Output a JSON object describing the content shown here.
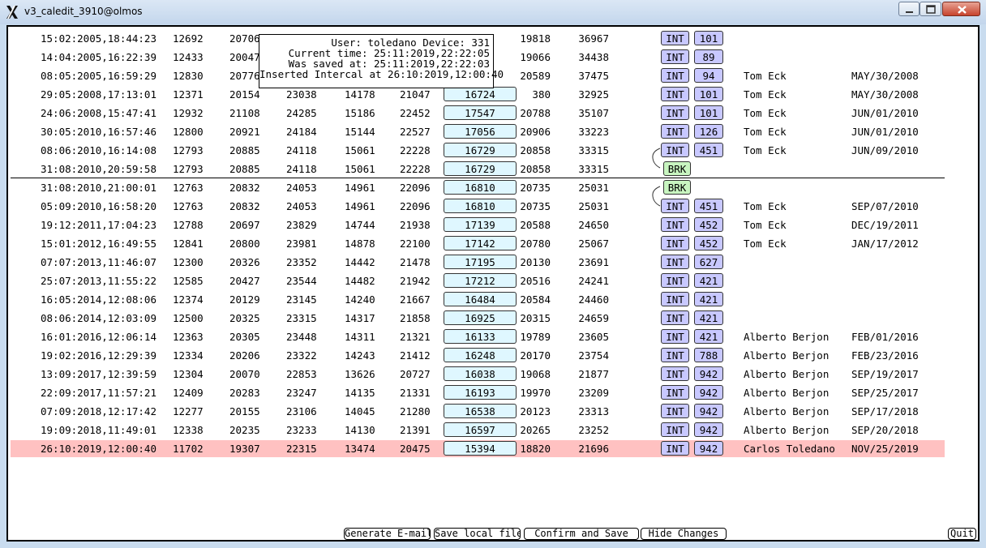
{
  "window": {
    "title": "v3_caledit_3910@olmos",
    "controls": [
      "minimize-icon",
      "maximize-icon",
      "close-icon"
    ]
  },
  "overlay": {
    "user_line": "User: toledano Device: 331",
    "current_time_line": "Current time: 25:11:2019,22:22:05",
    "saved_line": "Was saved at: 25:11:2019,22:22:03",
    "inserted_line": "Inserted Intercal at 26:10:2019,12:00:40"
  },
  "rows_before_break": [
    {
      "ts": "15:02:2005,18:44:23",
      "a": "12692",
      "b": "20706",
      "c": "",
      "d": "",
      "e": "",
      "id": "",
      "f": "19818",
      "g": "36967",
      "tag": "INT",
      "num": "101",
      "name": "",
      "date": ""
    },
    {
      "ts": "14:04:2005,16:22:39",
      "a": "12433",
      "b": "20047",
      "c": "",
      "d": "",
      "e": "",
      "id": "",
      "f": "19066",
      "g": "34438",
      "tag": "INT",
      "num": "89",
      "name": "",
      "date": ""
    },
    {
      "ts": "08:05:2005,16:59:29",
      "a": "12830",
      "b": "20776",
      "c": "",
      "d": "",
      "e": "",
      "id": "",
      "f": "20589",
      "g": "37475",
      "tag": "INT",
      "num": "94",
      "name": "Tom Eck",
      "date": "MAY/30/2008"
    },
    {
      "ts": "29:05:2008,17:13:01",
      "a": "12371",
      "b": "20154",
      "c": "23038",
      "d": "14178",
      "e": "21047",
      "id": "16724",
      "f": "380",
      "g": "32925",
      "tag": "INT",
      "num": "101",
      "name": "Tom Eck",
      "date": "MAY/30/2008"
    },
    {
      "ts": "24:06:2008,15:47:41",
      "a": "12932",
      "b": "21108",
      "c": "24285",
      "d": "15186",
      "e": "22452",
      "id": "17547",
      "f": "20788",
      "g": "35107",
      "tag": "INT",
      "num": "101",
      "name": "Tom Eck",
      "date": "JUN/01/2010"
    },
    {
      "ts": "30:05:2010,16:57:46",
      "a": "12800",
      "b": "20921",
      "c": "24184",
      "d": "15144",
      "e": "22527",
      "id": "17056",
      "f": "20906",
      "g": "33223",
      "tag": "INT",
      "num": "126",
      "name": "Tom Eck",
      "date": "JUN/01/2010"
    },
    {
      "ts": "08:06:2010,16:14:08",
      "a": "12793",
      "b": "20885",
      "c": "24118",
      "d": "15061",
      "e": "22228",
      "id": "16729",
      "f": "20858",
      "g": "33315",
      "tag": "INT",
      "num": "451",
      "name": "Tom Eck",
      "date": "JUN/09/2010"
    },
    {
      "ts": "31:08:2010,20:59:58",
      "a": "12793",
      "b": "20885",
      "c": "24118",
      "d": "15061",
      "e": "22228",
      "id": "16729",
      "f": "20858",
      "g": "33315",
      "tag": "BRK",
      "num": "",
      "name": "",
      "date": ""
    }
  ],
  "rows_after_break": [
    {
      "ts": "31:08:2010,21:00:01",
      "a": "12763",
      "b": "20832",
      "c": "24053",
      "d": "14961",
      "e": "22096",
      "id": "16810",
      "f": "20735",
      "g": "25031",
      "tag": "BRK",
      "num": "",
      "name": "",
      "date": ""
    },
    {
      "ts": "05:09:2010,16:58:20",
      "a": "12763",
      "b": "20832",
      "c": "24053",
      "d": "14961",
      "e": "22096",
      "id": "16810",
      "f": "20735",
      "g": "25031",
      "tag": "INT",
      "num": "451",
      "name": "Tom Eck",
      "date": "SEP/07/2010"
    },
    {
      "ts": "19:12:2011,17:04:23",
      "a": "12788",
      "b": "20697",
      "c": "23829",
      "d": "14744",
      "e": "21938",
      "id": "17139",
      "f": "20588",
      "g": "24650",
      "tag": "INT",
      "num": "452",
      "name": "Tom Eck",
      "date": "DEC/19/2011"
    },
    {
      "ts": "15:01:2012,16:49:55",
      "a": "12841",
      "b": "20800",
      "c": "23981",
      "d": "14878",
      "e": "22100",
      "id": "17142",
      "f": "20780",
      "g": "25067",
      "tag": "INT",
      "num": "452",
      "name": "Tom Eck",
      "date": "JAN/17/2012"
    },
    {
      "ts": "07:07:2013,11:46:07",
      "a": "12300",
      "b": "20326",
      "c": "23352",
      "d": "14442",
      "e": "21478",
      "id": "17195",
      "f": "20130",
      "g": "23691",
      "tag": "INT",
      "num": "627",
      "name": "",
      "date": ""
    },
    {
      "ts": "25:07:2013,11:55:22",
      "a": "12585",
      "b": "20427",
      "c": "23544",
      "d": "14482",
      "e": "21942",
      "id": "17212",
      "f": "20516",
      "g": "24241",
      "tag": "INT",
      "num": "421",
      "name": "",
      "date": ""
    },
    {
      "ts": "16:05:2014,12:08:06",
      "a": "12374",
      "b": "20129",
      "c": "23145",
      "d": "14240",
      "e": "21667",
      "id": "16484",
      "f": "20584",
      "g": "24460",
      "tag": "INT",
      "num": "421",
      "name": "",
      "date": ""
    },
    {
      "ts": "08:06:2014,12:03:09",
      "a": "12500",
      "b": "20325",
      "c": "23315",
      "d": "14317",
      "e": "21858",
      "id": "16925",
      "f": "20315",
      "g": "24659",
      "tag": "INT",
      "num": "421",
      "name": "",
      "date": ""
    },
    {
      "ts": "16:01:2016,12:06:14",
      "a": "12363",
      "b": "20305",
      "c": "23448",
      "d": "14311",
      "e": "21321",
      "id": "16133",
      "f": "19789",
      "g": "23605",
      "tag": "INT",
      "num": "421",
      "name": "Alberto Berjon",
      "date": "FEB/01/2016"
    },
    {
      "ts": "19:02:2016,12:29:39",
      "a": "12334",
      "b": "20206",
      "c": "23322",
      "d": "14243",
      "e": "21412",
      "id": "16248",
      "f": "20170",
      "g": "23754",
      "tag": "INT",
      "num": "788",
      "name": "Alberto Berjon",
      "date": "FEB/23/2016"
    },
    {
      "ts": "13:09:2017,12:39:59",
      "a": "12304",
      "b": "20070",
      "c": "22853",
      "d": "13626",
      "e": "20727",
      "id": "16038",
      "f": "19068",
      "g": "21877",
      "tag": "INT",
      "num": "942",
      "name": "Alberto Berjon",
      "date": "SEP/19/2017"
    },
    {
      "ts": "22:09:2017,11:57:21",
      "a": "12409",
      "b": "20283",
      "c": "23247",
      "d": "14135",
      "e": "21331",
      "id": "16193",
      "f": "19970",
      "g": "23209",
      "tag": "INT",
      "num": "942",
      "name": "Alberto Berjon",
      "date": "SEP/25/2017"
    },
    {
      "ts": "07:09:2018,12:17:42",
      "a": "12277",
      "b": "20155",
      "c": "23106",
      "d": "14045",
      "e": "21280",
      "id": "16538",
      "f": "20123",
      "g": "23313",
      "tag": "INT",
      "num": "942",
      "name": "Alberto Berjon",
      "date": "SEP/17/2018"
    },
    {
      "ts": "19:09:2018,11:49:01",
      "a": "12338",
      "b": "20235",
      "c": "23233",
      "d": "14130",
      "e": "21391",
      "id": "16597",
      "f": "20265",
      "g": "23252",
      "tag": "INT",
      "num": "942",
      "name": "Alberto Berjon",
      "date": "SEP/20/2018"
    },
    {
      "ts": "26:10:2019,12:00:40",
      "a": "11702",
      "b": "19307",
      "c": "22315",
      "d": "13474",
      "e": "20475",
      "id": "15394",
      "f": "18820",
      "g": "21696",
      "tag": "INT",
      "num": "942",
      "name": "Carlos Toledano",
      "date": "NOV/25/2019",
      "highlighted": true
    }
  ],
  "buttons": {
    "generate_email": "Generate E-mail",
    "save_local": "Save local file",
    "confirm_save": "Confirm and Save",
    "hide_changes": "Hide Changes",
    "quit": "Quit"
  },
  "colors": {
    "highlight_row": "#ffc1c1",
    "int_tag": "#c8c8ff",
    "brk_tag": "#c8f5c0",
    "id_box": "#dff7ff"
  }
}
